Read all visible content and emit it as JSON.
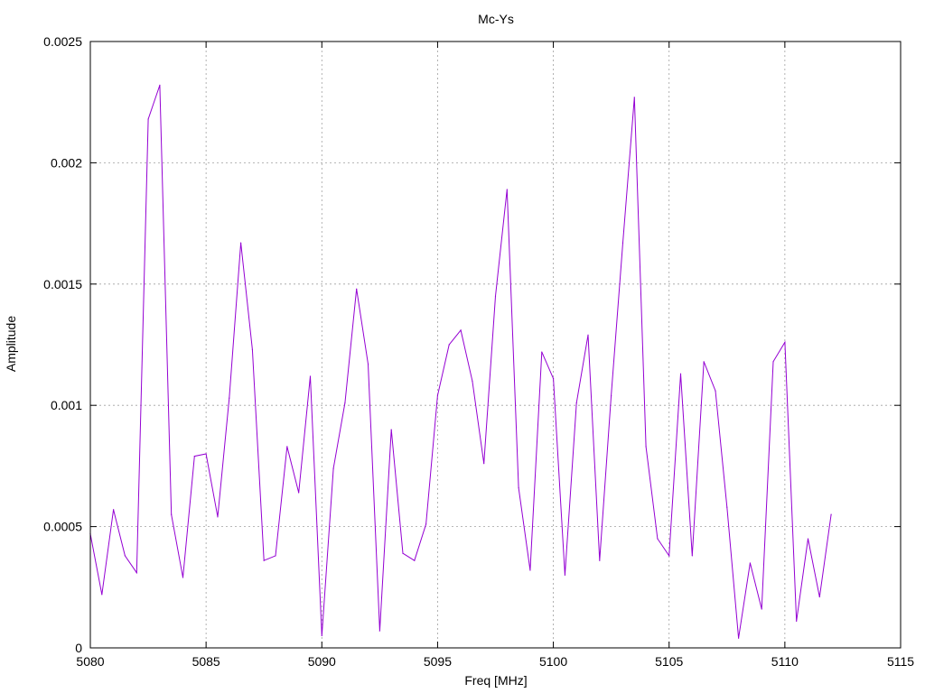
{
  "chart_data": {
    "type": "line",
    "title": "Mc-Ys",
    "xlabel": "Freq [MHz]",
    "ylabel": "Amplitude",
    "xlim": [
      5080,
      5115
    ],
    "ylim": [
      0,
      0.0025
    ],
    "x_ticks": [
      "5080",
      "5085",
      "5090",
      "5095",
      "5100",
      "5105",
      "5110",
      "5115"
    ],
    "y_ticks": [
      "0",
      "0.0005",
      "0.001",
      "0.0015",
      "0.002",
      "0.0025"
    ],
    "grid": true,
    "line_color": "#9400d3",
    "series": [
      {
        "x": [
          5080,
          5080.5,
          5081,
          5081.5,
          5082,
          5082.5,
          5083,
          5083.5,
          5084,
          5084.5,
          5085,
          5085.5,
          5086,
          5086.5,
          5087,
          5087.5,
          5088,
          5088.5,
          5089,
          5089.5,
          5090,
          5090.5,
          5091,
          5091.5,
          5092,
          5092.5,
          5093,
          5093.5,
          5094,
          5094.5,
          5095,
          5095.5,
          5096,
          5096.5,
          5097,
          5097.5,
          5098,
          5098.5,
          5099,
          5099.5,
          5100,
          5100.5,
          5101,
          5101.5,
          5102,
          5102.5,
          5103,
          5103.5,
          5104,
          5104.5,
          5105,
          5105.5,
          5106,
          5106.5,
          5107,
          5107.5,
          5108,
          5108.5,
          5109,
          5109.5,
          5110,
          5110.5,
          5111,
          5111.5,
          5112
        ],
        "y": [
          0.00047,
          0.00022,
          0.00057,
          0.00038,
          0.00031,
          0.00218,
          0.00232,
          0.00055,
          0.00029,
          0.00079,
          0.0008,
          0.00054,
          0.00103,
          0.00167,
          0.00123,
          0.00036,
          0.00038,
          0.00083,
          0.00064,
          0.00112,
          5e-05,
          0.00074,
          0.00101,
          0.00148,
          0.00117,
          7e-05,
          0.0009,
          0.00039,
          0.00036,
          0.00051,
          0.00104,
          0.00125,
          0.00131,
          0.0011,
          0.00076,
          0.00145,
          0.00189,
          0.00066,
          0.00032,
          0.00122,
          0.00111,
          0.0003,
          0.00101,
          0.00129,
          0.00036,
          0.00104,
          0.00167,
          0.00227,
          0.00083,
          0.00045,
          0.00038,
          0.00113,
          0.00038,
          0.00118,
          0.00106,
          0.00058,
          4e-05,
          0.00035,
          0.00016,
          0.00118,
          0.00126,
          0.00011,
          0.00045,
          0.00021,
          0.00055
        ]
      }
    ]
  }
}
